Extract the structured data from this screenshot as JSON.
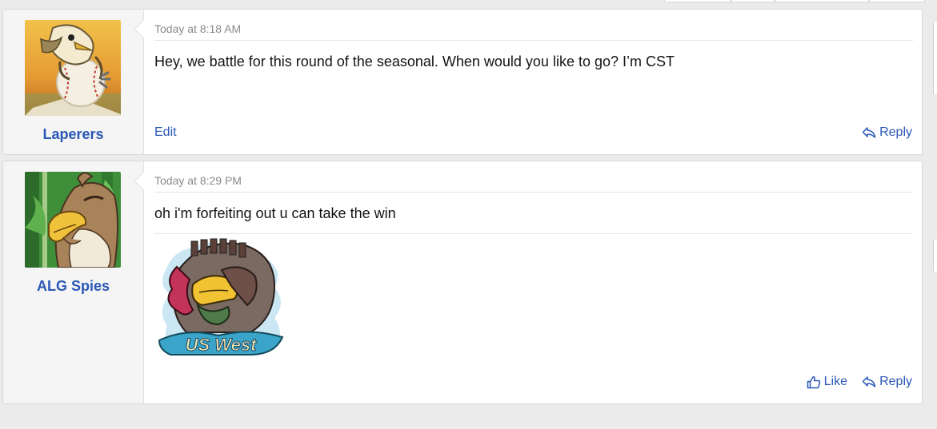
{
  "messages": [
    {
      "user": {
        "name": "Laperers",
        "avatar_icon": "bird-baseball-avatar"
      },
      "timestamp": "Today at 8:18 AM",
      "text": "Hey, we battle for this round of the seasonal. When would you like to go? I’m CST",
      "actions": {
        "edit_label": "Edit",
        "reply_label": "Reply"
      }
    },
    {
      "user": {
        "name": "ALG Spies",
        "avatar_icon": "farfetchd-avatar"
      },
      "timestamp": "Today at 8:29 PM",
      "text": "oh i'm forfeiting out u can take the win",
      "attachment": {
        "type": "image",
        "icon": "us-west-team-logo",
        "logo_text": "US West"
      },
      "actions": {
        "like_label": "Like",
        "reply_label": "Reply"
      }
    }
  ],
  "colors": {
    "link": "#2a58b6",
    "page_bg": "#ebebeb",
    "user_cell_bg": "#f5f5f5"
  }
}
